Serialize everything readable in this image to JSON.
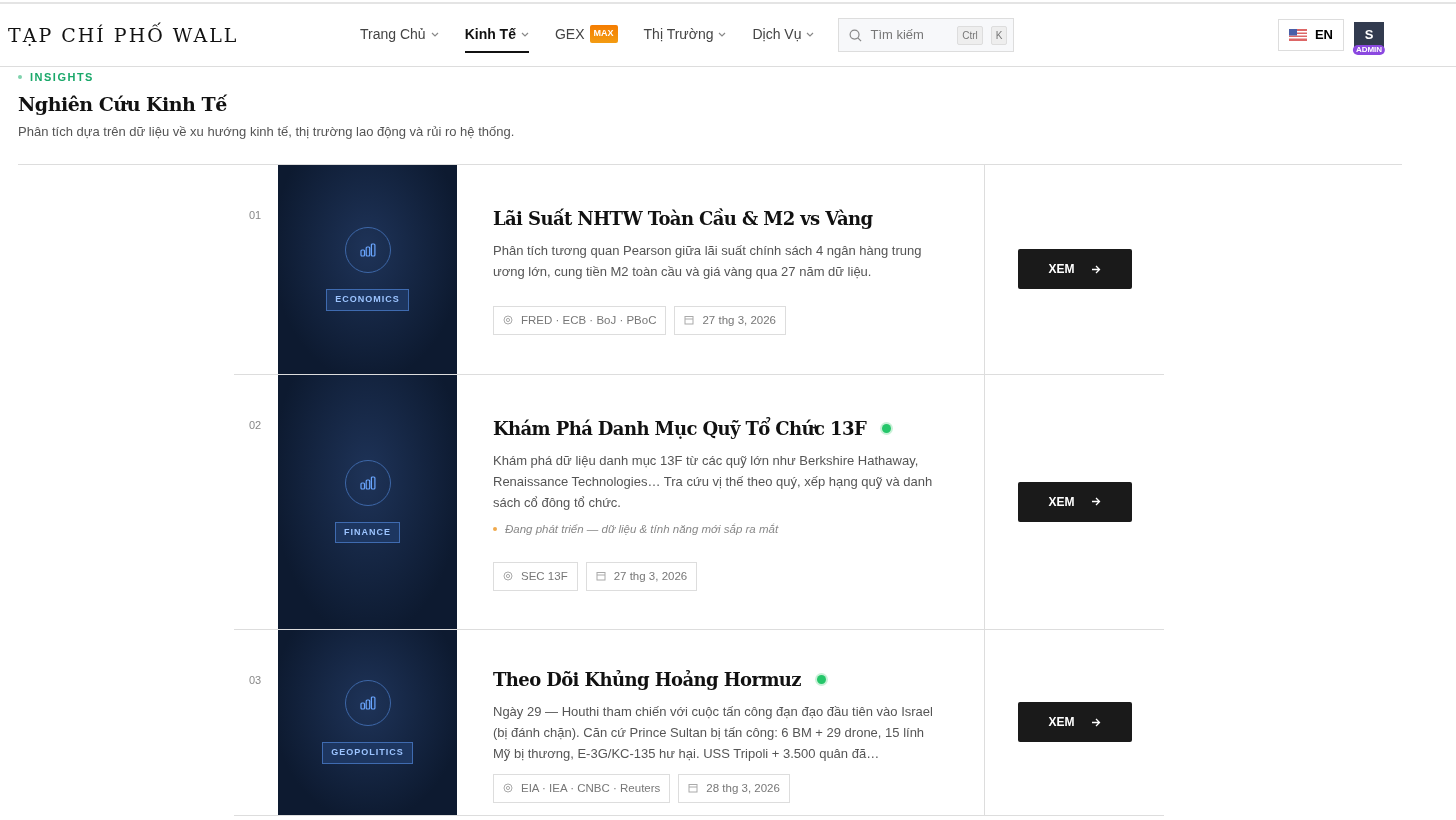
{
  "brand": "TẠP CHÍ PHỐ WALL",
  "nav": [
    {
      "label": "Trang Chủ",
      "caret": true,
      "selected": false
    },
    {
      "label": "Kinh Tế",
      "caret": true,
      "selected": true
    },
    {
      "label": "GEX",
      "caret": false,
      "selected": false,
      "badge": "MAX"
    },
    {
      "label": "Thị Trường",
      "caret": true,
      "selected": false
    },
    {
      "label": "Dịch Vụ",
      "caret": true,
      "selected": false
    }
  ],
  "search": {
    "placeholder": "Tìm kiếm",
    "keys": [
      "Ctrl",
      "K"
    ]
  },
  "language": "EN",
  "user": {
    "initial": "S",
    "role": "ADMIN"
  },
  "section": {
    "eyebrow": "INSIGHTS",
    "title": "Nghiên Cứu Kinh Tế",
    "subtitle": "Phân tích dựa trên dữ liệu về xu hướng kinh tế, thị trường lao động và rủi ro hệ thống."
  },
  "articles": [
    {
      "number": "01",
      "category": "ECONOMICS",
      "title": "Lãi Suất NHTW Toàn Cầu & M2 vs Vàng",
      "live": false,
      "description": "Phân tích tương quan Pearson giữa lãi suất chính sách 4 ngân hàng trung ương lớn, cung tiền M2 toàn cầu và giá vàng qua 27 năm dữ liệu.",
      "sources": "FRED · ECB · BoJ · PBoC",
      "date": "27 thg 3, 2026",
      "button": "XEM"
    },
    {
      "number": "02",
      "category": "FINANCE",
      "title": "Khám Phá Danh Mục Quỹ Tổ Chức 13F",
      "live": true,
      "description": "Khám phá dữ liệu danh mục 13F từ các quỹ lớn như Berkshire Hathaway, Renaissance Technologies… Tra cứu vị thế theo quý, xếp hạng quỹ và danh sách cổ đông tổ chức.",
      "note": "Đang phát triển — dữ liệu & tính năng mới sắp ra mắt",
      "sources": "SEC 13F",
      "date": "27 thg 3, 2026",
      "button": "XEM"
    },
    {
      "number": "03",
      "category": "GEOPOLITICS",
      "title": "Theo Dõi Khủng Hoảng Hormuz",
      "live": true,
      "description": "Ngày 29 — Houthi tham chiến với cuộc tấn công đạn đạo đầu tiên vào Israel (bị đánh chặn). Căn cứ Prince Sultan bị tấn công: 6 BM + 29 drone, 15 lính Mỹ bị thương, E-3G/KC-135 hư hại. USS Tripoli + 3.500 quân đã…",
      "sources": "EIA · IEA · CNBC · Reuters",
      "date": "28 thg 3, 2026",
      "button": "XEM"
    }
  ]
}
